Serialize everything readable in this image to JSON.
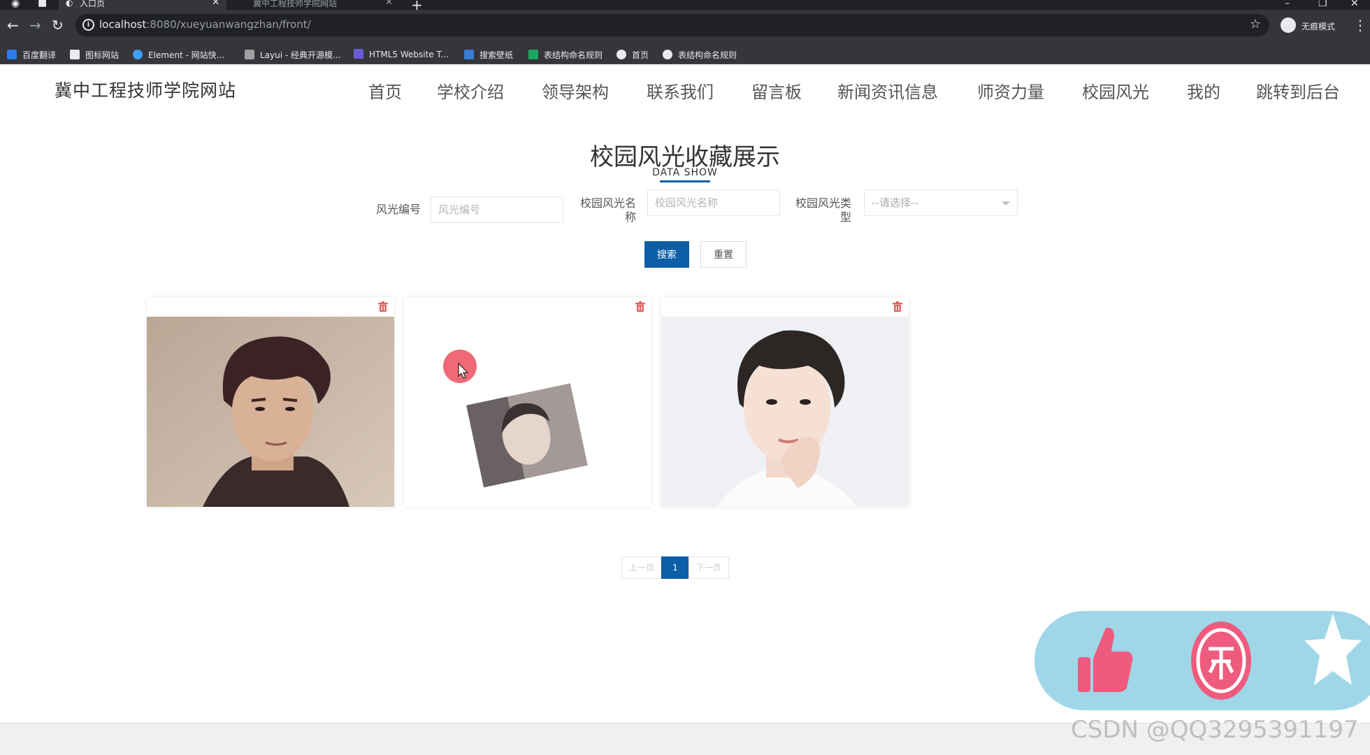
{
  "browser": {
    "tabs": [
      {
        "label": "入口页",
        "active": true
      },
      {
        "label": "冀中工程技师学院网站",
        "active": false
      }
    ],
    "new_tab": "+",
    "url_host": "localhost",
    "url_rest": ":8080/xueyuanwangzhan/front/",
    "profile_label": "无痕模式",
    "bookmarks": [
      {
        "label": "百度翻译",
        "icon": "baidu-translate-icon",
        "color": "#2b7de9"
      },
      {
        "label": "图标网站",
        "icon": "flag-icon",
        "color": "#e8eaed"
      },
      {
        "label": "Element - 网站快...",
        "icon": "element-icon",
        "color": "#409eff"
      },
      {
        "label": "Layui - 经典开源模...",
        "icon": "layui-icon",
        "color": "#a0a0a0"
      },
      {
        "label": "HTML5 Website T...",
        "icon": "html5-icon",
        "color": "#6b5bd6"
      },
      {
        "label": "搜索壁纸",
        "icon": "wallpaper-icon",
        "color": "#3a7bd5"
      },
      {
        "label": "表结构命名规则",
        "icon": "sheet-icon",
        "color": "#1fa463"
      },
      {
        "label": "首页",
        "icon": "globe-icon",
        "color": "#e8eaed"
      },
      {
        "label": "表结构命名规则",
        "icon": "globe-icon",
        "color": "#e8eaed"
      }
    ]
  },
  "header": {
    "site_title": "冀中工程技师学院网站",
    "nav": [
      "首页",
      "学校介绍",
      "领导架构",
      "联系我们",
      "留言板",
      "新闻资讯信息",
      "师资力量",
      "校园风光",
      "我的",
      "跳转到后台"
    ]
  },
  "section": {
    "title": "校园风光收藏展示",
    "subtitle": "DATA SHOW"
  },
  "search": {
    "field1_label": "风光编号",
    "field1_placeholder": "风光编号",
    "field2_label_line1": "校园风光名",
    "field2_label_line2": "称",
    "field2_placeholder": "校园风光名称",
    "field3_label_line1": "校园风光类",
    "field3_label_line2": "型",
    "field3_selected": "--请选择--",
    "search_button": "搜索",
    "reset_button": "重置"
  },
  "cards": [
    {
      "photo": "portrait-dark-hair-jacket"
    },
    {
      "photo": "rotated-small-portrait"
    },
    {
      "photo": "portrait-white-shirt"
    }
  ],
  "pagination": {
    "prev": "上一页",
    "current": "1",
    "next": "下一页"
  },
  "overlay": {
    "actions": [
      "thumbs-up-icon",
      "coin-icon",
      "star-icon"
    ]
  },
  "watermark": "CSDN @QQ3295391197",
  "colors": {
    "primary": "#0c5ea6",
    "overlay_bg": "#9fd7e9",
    "like": "#ee5b7e",
    "delete_icon": "#e06060"
  }
}
